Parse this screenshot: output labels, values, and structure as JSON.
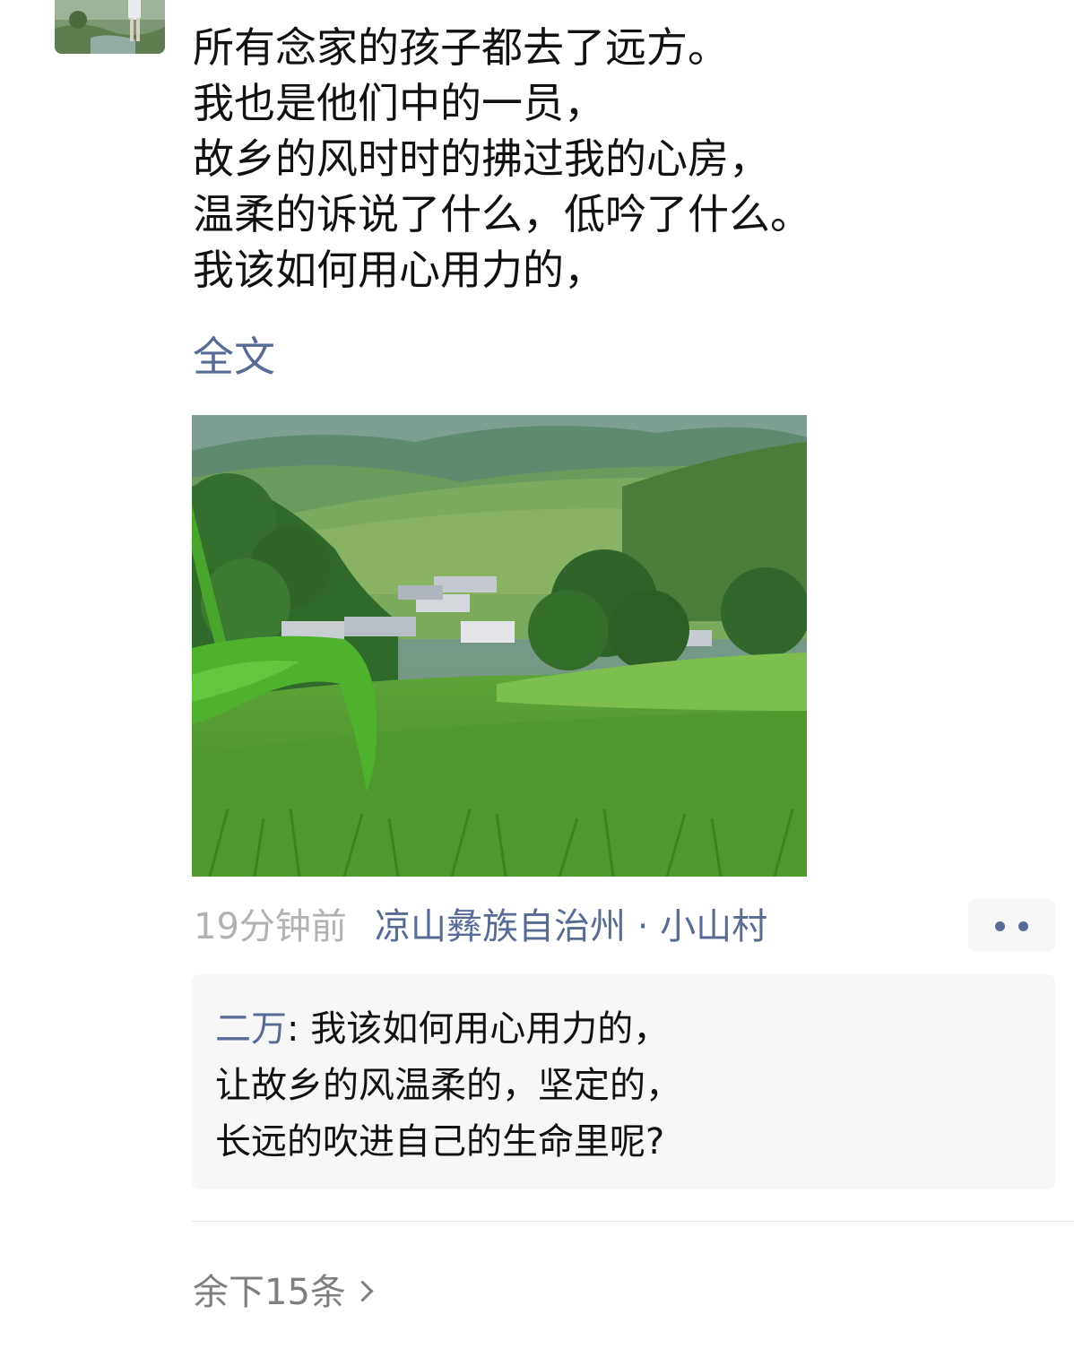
{
  "post": {
    "lines": [
      "所有念家的孩子都去了远方。",
      "我也是他们中的一员，",
      "故乡的风时时的拂过我的心房，",
      "温柔的诉说了什么，低吟了什么。",
      "我该如何用心用力的，"
    ],
    "full_text_label": "全文"
  },
  "meta": {
    "timestamp": "19分钟前",
    "location": "凉山彝族自治州 · 小山村"
  },
  "comment": {
    "author": "二万",
    "separator": ": ",
    "lines": [
      "我该如何用心用力的，",
      "让故乡的风温柔的，坚定的，",
      "长远的吹进自己的生命里呢?"
    ]
  },
  "remaining_label": "余下15条",
  "colors": {
    "link": "#576b95",
    "text": "#111111",
    "muted": "#b2b2b2",
    "panel": "#f7f7f7"
  },
  "icons": {
    "more": "more-dots-icon",
    "chevron": "chevron-right-icon"
  }
}
